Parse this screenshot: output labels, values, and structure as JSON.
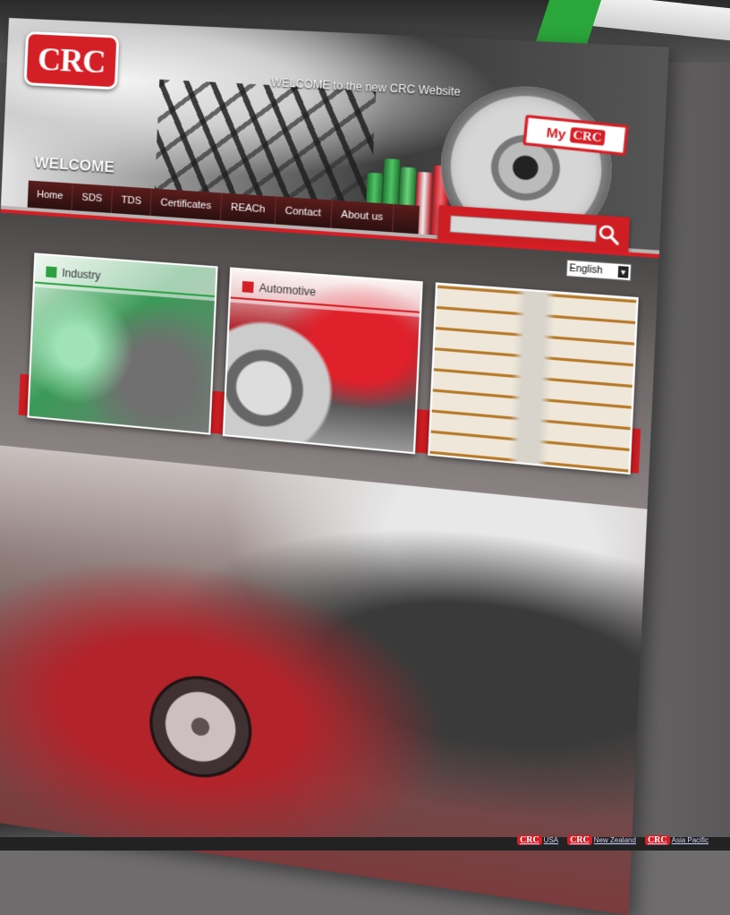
{
  "site": {
    "logo_text": "CRC",
    "welcome_banner": "WELCOME to the new CRC Website",
    "welcome_heading": "WELCOME",
    "my_crc": {
      "label": "My",
      "badge": "CRC"
    }
  },
  "nav": {
    "items": [
      {
        "label": "Home"
      },
      {
        "label": "SDS"
      },
      {
        "label": "TDS"
      },
      {
        "label": "Certificates"
      },
      {
        "label": "REACh"
      },
      {
        "label": "Contact"
      },
      {
        "label": "About us"
      }
    ]
  },
  "search": {
    "value": "",
    "icon": "search-icon"
  },
  "language": {
    "selected": "English"
  },
  "categories": [
    {
      "label": "Industry",
      "accent": "#2ea043"
    },
    {
      "label": "Automotive",
      "accent": "#d51f26"
    },
    {
      "label": "",
      "accent": ""
    }
  ],
  "partners": [
    {
      "badge": "CRC",
      "label": "USA"
    },
    {
      "badge": "CRC",
      "label": "New Zealand"
    },
    {
      "badge": "CRC",
      "label": "Asia Pacific"
    }
  ],
  "colors": {
    "brand_red": "#d51f26",
    "industry_green": "#2ea043"
  }
}
